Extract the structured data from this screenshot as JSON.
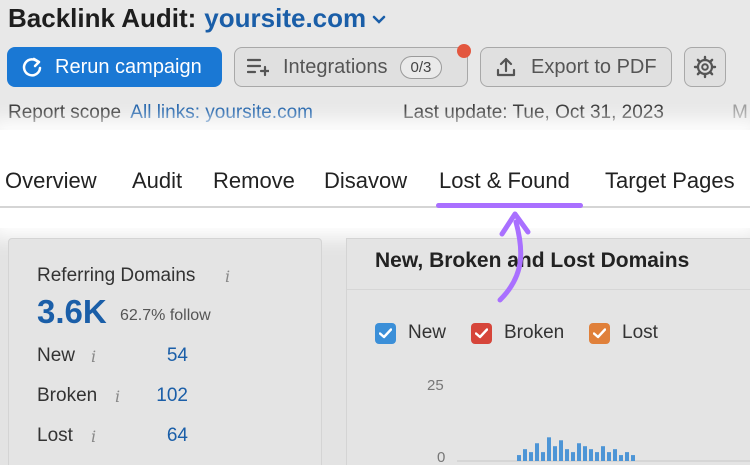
{
  "header": {
    "title": "Backlink Audit:",
    "domain": "yoursite.com",
    "rerun_label": "Rerun campaign",
    "integrations_label": "Integrations",
    "integrations_count": "0/3",
    "export_label": "Export to PDF",
    "scope_label": "Report scope",
    "scope_link": "All links: yoursite.com",
    "last_update": "Last update: Tue, Oct 31, 2023",
    "trailing": "M"
  },
  "tabs": [
    "Overview",
    "Audit",
    "Remove",
    "Disavow",
    "Lost & Found",
    "Target Pages"
  ],
  "active_tab": "Lost & Found",
  "referring": {
    "title": "Referring Domains",
    "value": "3.6K",
    "follow": "62.7% follow",
    "rows": [
      {
        "label": "New",
        "value": "54"
      },
      {
        "label": "Broken",
        "value": "102"
      },
      {
        "label": "Lost",
        "value": "64"
      }
    ]
  },
  "chart_panel": {
    "title": "New, Broken and Lost Domains",
    "legend": [
      {
        "label": "New",
        "color": "#3b8fd8"
      },
      {
        "label": "Broken",
        "color": "#d6453a"
      },
      {
        "label": "Lost",
        "color": "#e0803a"
      }
    ]
  },
  "chart_data": {
    "type": "bar",
    "title": "New, Broken and Lost Domains",
    "ylim": [
      0,
      25
    ],
    "yticks": [
      "25",
      "0"
    ],
    "series": [
      {
        "name": "New",
        "color": "#4d95d6",
        "values": [
          2,
          4,
          3,
          6,
          3,
          8,
          5,
          7,
          4,
          3,
          6,
          5,
          4,
          3,
          5,
          3,
          4,
          2,
          3,
          2
        ]
      }
    ]
  },
  "colors": {
    "accent": "#1a78d4",
    "link": "#1a5ea8",
    "highlight": "#a970ff"
  }
}
